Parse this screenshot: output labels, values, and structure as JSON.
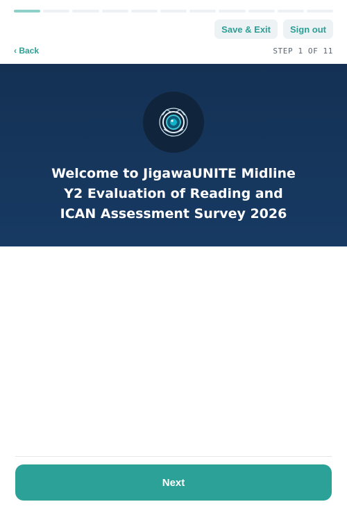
{
  "progress": {
    "current_step": 1,
    "total_steps": 11
  },
  "header": {
    "save_exit_label": "Save & Exit",
    "sign_out_label": "Sign out",
    "back_label": "‹ Back",
    "step_label": "STEP 1 OF 11"
  },
  "hero": {
    "logo_icon": "survey-logo-icon",
    "title_lines": [
      "Welcome to JigawaUNITE Midline",
      "Y2 Evaluation of Reading and",
      "ICAN Assessment Survey 2026"
    ]
  },
  "footer": {
    "next_label": "Next"
  },
  "colors": {
    "accent": "#2ba197",
    "hero_bg": "#173a63",
    "progress_active": "#8fd0cb"
  }
}
